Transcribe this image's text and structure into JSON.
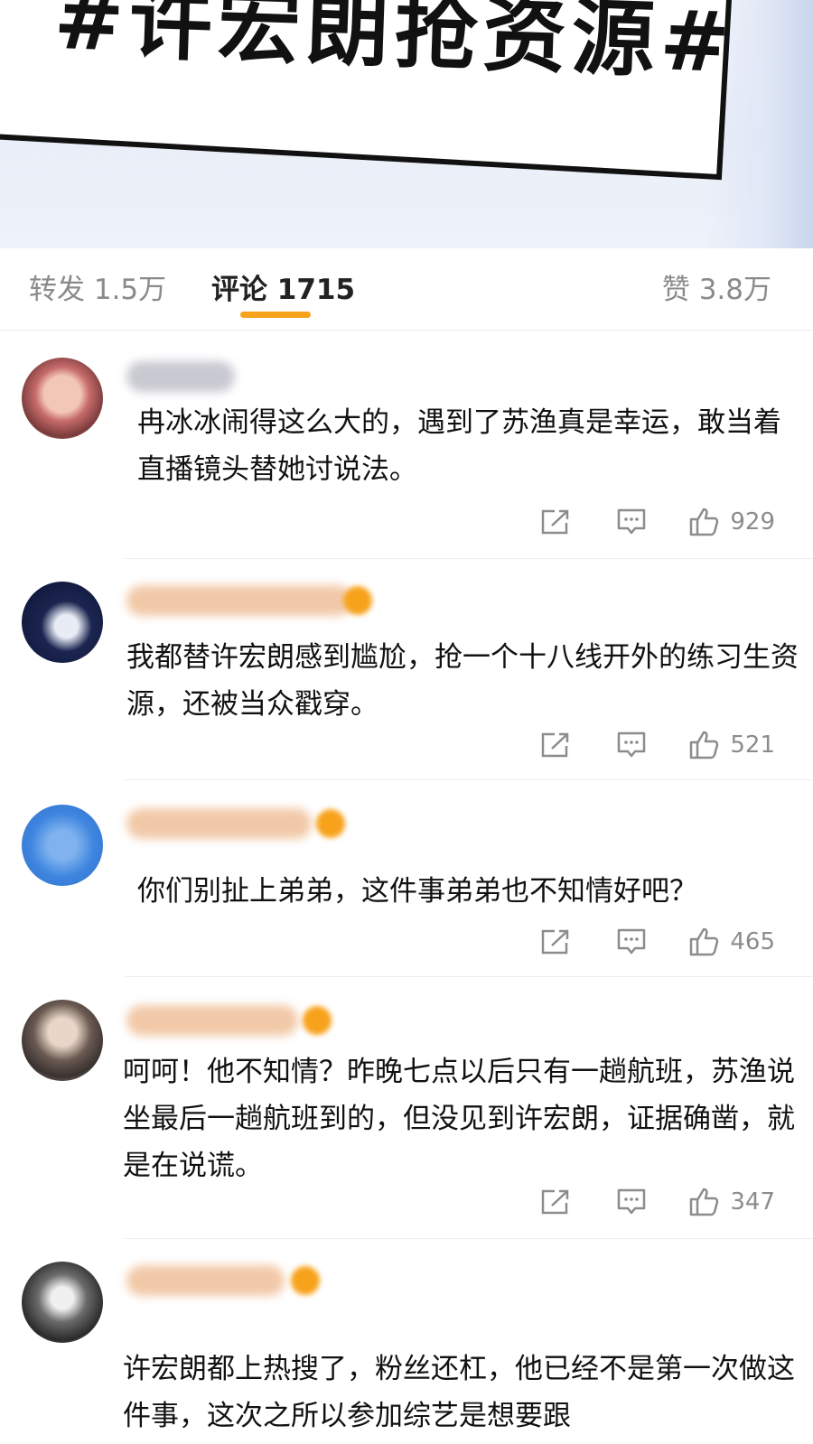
{
  "banner": {
    "title": "#许宏朗抢资源#"
  },
  "stats": {
    "repost_label": "转发 1.5万",
    "comment_label": "评论 1715",
    "like_label": "赞 3.8万"
  },
  "colors": {
    "accent": "#f7a21b",
    "muted_text": "#8a8a8a",
    "divider": "#ededed"
  },
  "icons": {
    "share": "share-icon",
    "reply": "comment-icon",
    "like": "thumbs-up-icon"
  },
  "comments": [
    {
      "text": "冉冰冰闹得这么大的，遇到了苏渔真是幸运，敢当着直播镜头替她讨说法。",
      "likes": "929"
    },
    {
      "text": "我都替许宏朗感到尴尬，抢一个十八线开外的练习生资源，还被当众戳穿。",
      "likes": "521"
    },
    {
      "text": "你们别扯上弟弟，这件事弟弟也不知情好吧？",
      "likes": "465"
    },
    {
      "text": "呵呵！他不知情？昨晚七点以后只有一趟航班，苏渔说坐最后一趟航班到的，但没见到许宏朗，证据确凿，就是在说谎。",
      "likes": "347"
    },
    {
      "text": "许宏朗都上热搜了，粉丝还杠，他已经不是第一次做这件事，这次之所以参加综艺是想要跟"
    }
  ]
}
